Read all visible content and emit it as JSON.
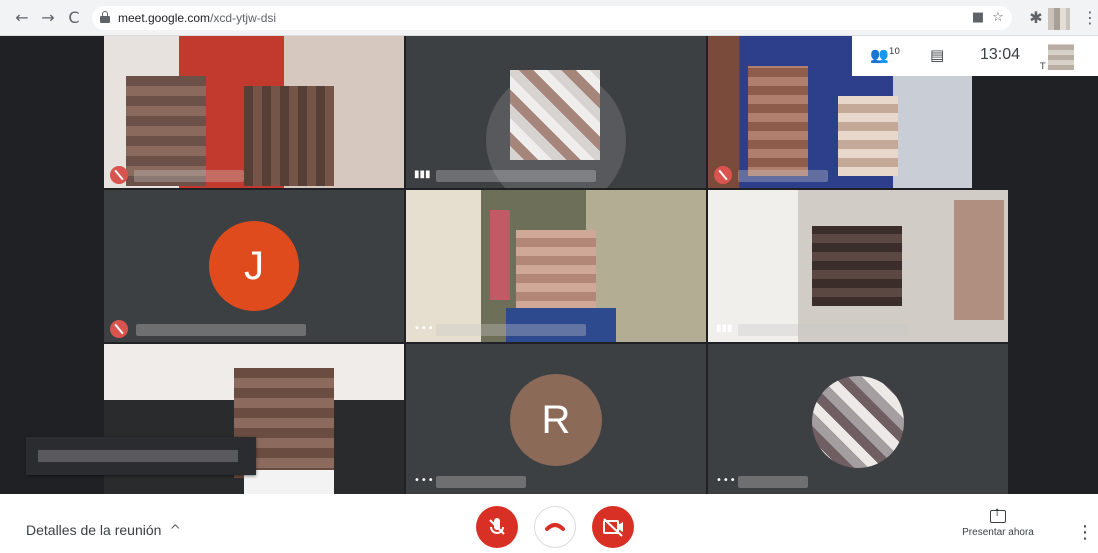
{
  "browser": {
    "url_host": "meet.google.com",
    "url_path": "/xcd-ytjw-dsi",
    "back_icon": "←",
    "forward_icon": "→",
    "reload_icon": "C"
  },
  "meeting_info": {
    "participant_count": "10",
    "time": "13:04",
    "user_initial": "T"
  },
  "tiles": {
    "avatar_j": "J",
    "avatar_r": "R"
  },
  "controls": {
    "details_label": "Detalles de la reunión",
    "details_chevron": "^",
    "present_label": "Presentar ahora",
    "more_icon": "⋮"
  },
  "colors": {
    "accent_red": "#d93025",
    "avatar_j": "#e04b1e",
    "avatar_r": "#8b6a58",
    "stage_bg": "#202124"
  }
}
